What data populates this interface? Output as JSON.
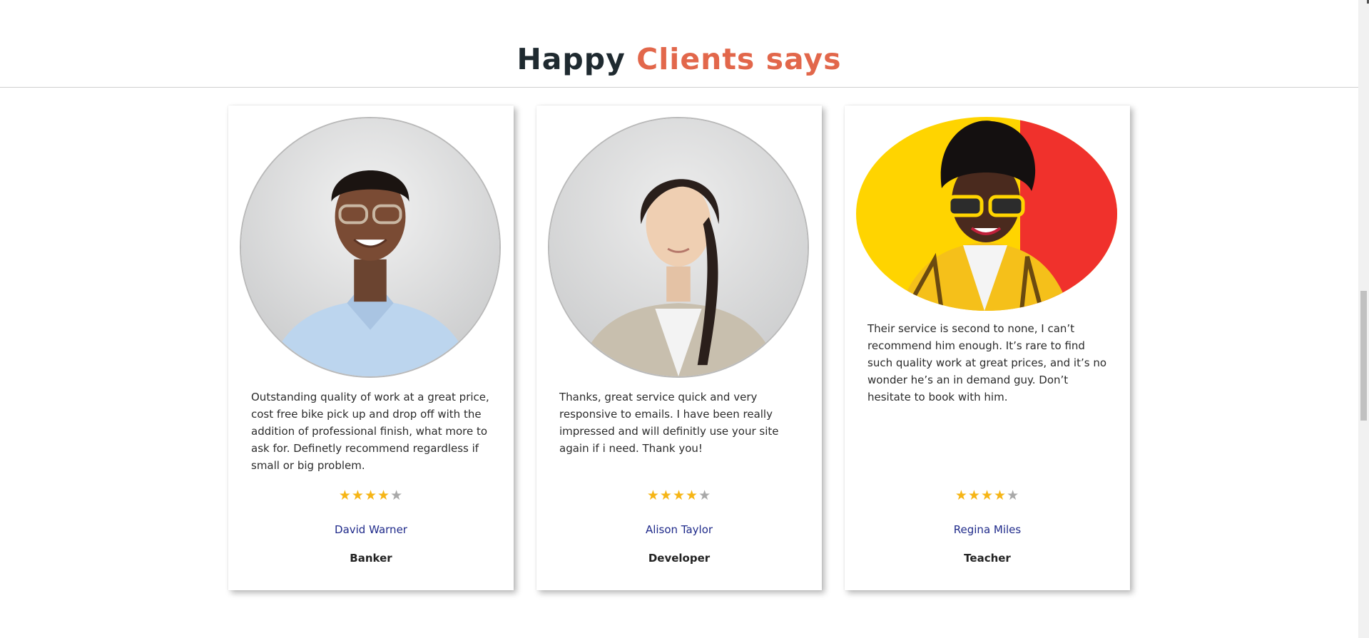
{
  "section": {
    "title_main": "Happy",
    "title_accent": "Clients says",
    "accent_color": "#e2674b"
  },
  "testimonials": [
    {
      "quote": "Outstanding quality of work at a great price, cost free bike pick up and drop off with the addition of professional finish, what more to ask for. Definetly recommend regardless if small or big problem.",
      "rating": 4,
      "max_rating": 5,
      "name": "David Warner",
      "role": "Banker"
    },
    {
      "quote": "Thanks, great service quick and very responsive to emails. I have been really impressed and will definitly use your site again if i need. Thank you!",
      "rating": 4,
      "max_rating": 5,
      "name": "Alison Taylor",
      "role": "Developer"
    },
    {
      "quote": "Their service is second to none, I can’t recommend him enough. It’s rare to find such quality work at great prices, and it’s no wonder he’s an in demand guy. Don’t hesitate to book with him.",
      "rating": 4,
      "max_rating": 5,
      "name": "Regina Miles",
      "role": "Teacher"
    }
  ],
  "colors": {
    "star_on": "#f6b516",
    "star_off": "#a9a9a9",
    "name": "#1f2a8a"
  }
}
